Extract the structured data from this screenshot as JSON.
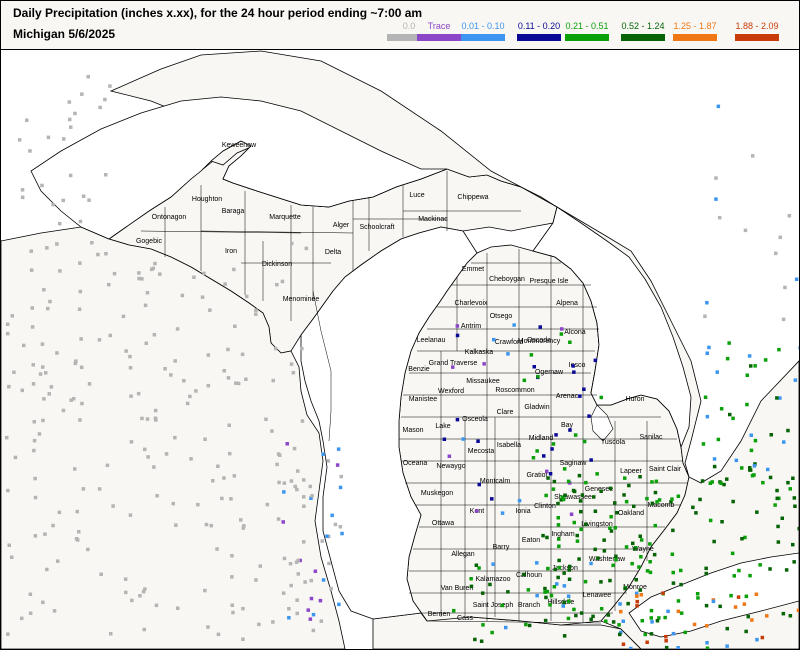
{
  "header": {
    "title": "Daily Precipitation (inches  x.xx),  for the 24 hour period ending ~7:00 am",
    "subtitle": "Michigan 5/6/2025"
  },
  "legend": [
    {
      "label": "0.0",
      "color": "#b4b4b4"
    },
    {
      "label": "Trace",
      "color": "#8c46c8"
    },
    {
      "label": "0.01 - 0.10",
      "color": "#3c96f0"
    },
    {
      "label": "0.11 - 0.20",
      "color": "#0a0a96"
    },
    {
      "label": "0.21 - 0.51",
      "color": "#0aa00a"
    },
    {
      "label": "0.52 - 1.24",
      "color": "#066406"
    },
    {
      "label": "1.25 - 1.87",
      "color": "#f07814"
    },
    {
      "label": "1.88 - 2.09",
      "color": "#c83c0a"
    }
  ],
  "counties": [
    "Keweenaw",
    "Houghton",
    "Ontonagon",
    "Baraga",
    "Marquette",
    "Alger",
    "Luce",
    "Chippewa",
    "Schoolcraft",
    "Mackinac",
    "Gogebic",
    "Iron",
    "Dickinson",
    "Delta",
    "Menominee",
    "Emmet",
    "Cheboygan",
    "Presque Isle",
    "Charlevoix",
    "Otsego",
    "Montmorency",
    "Alpena",
    "Antrim",
    "Leelanau",
    "Kalkaska",
    "Crawford",
    "Oscoda",
    "Alcona",
    "Benzie",
    "Grand Traverse",
    "Ogemaw",
    "Iosco",
    "Missaukee",
    "Roscommon",
    "Wexford",
    "Manistee",
    "Arenac",
    "Huron",
    "Gladwin",
    "Clare",
    "Osceola",
    "Lake",
    "Mason",
    "Bay",
    "Tuscola",
    "Sanilac",
    "Isabella",
    "Midland",
    "Mecosta",
    "Newaygo",
    "Oceana",
    "Saginaw",
    "Lapeer",
    "Saint Clair",
    "Montcalm",
    "Gratiot",
    "Muskegon",
    "Genesee",
    "Kent",
    "Ionia",
    "Clinton",
    "Shiawassee",
    "Ottawa",
    "Oakland",
    "Macomb",
    "Livingston",
    "Ingham",
    "Eaton",
    "Barry",
    "Allegan",
    "Wayne",
    "Washtenaw",
    "Jackson",
    "Calhoun",
    "Kalamazoo",
    "Van Buren",
    "Monroe",
    "Lenawee",
    "Hillsdale",
    "Branch",
    "Saint Joseph",
    "Cass",
    "Berrien"
  ]
}
